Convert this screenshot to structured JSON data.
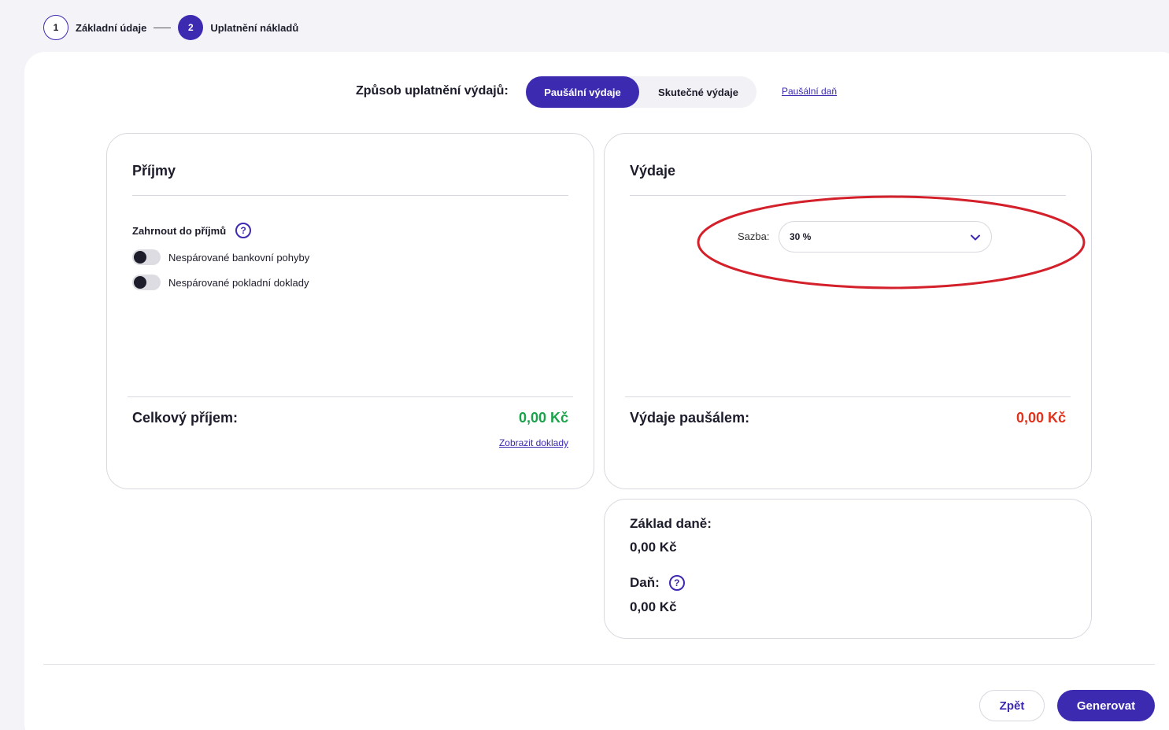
{
  "stepper": {
    "steps": [
      {
        "number": "1",
        "label": "Základní údaje",
        "state": "inactive"
      },
      {
        "number": "2",
        "label": "Uplatnění nákladů",
        "state": "active"
      }
    ]
  },
  "method": {
    "label": "Způsob uplatnění výdajů:",
    "options": [
      "Paušální výdaje",
      "Skutečné výdaje"
    ],
    "selected": "Paušální výdaje",
    "link": "Paušální daň"
  },
  "income": {
    "title": "Příjmy",
    "include_label": "Zahrnout do příjmů",
    "help_icon": "?",
    "toggles": [
      {
        "label": "Nespárované bankovní pohyby",
        "on": false
      },
      {
        "label": "Nespárované pokladní doklady",
        "on": false
      }
    ],
    "total_label": "Celkový příjem:",
    "total_value": "0,00 Kč",
    "total_color": "#1aa34a",
    "link": "Zobrazit doklady"
  },
  "expenses": {
    "title": "Výdaje",
    "rate_label": "Sazba:",
    "rate_value": "30 %",
    "total_label": "Výdaje paušálem:",
    "total_value": "0,00 Kč",
    "total_color": "#e0321c"
  },
  "tax": {
    "base_label": "Základ daně:",
    "base_value": "0,00 Kč",
    "tax_label": "Daň:",
    "help_icon": "?",
    "tax_value": "0,00 Kč"
  },
  "actions": {
    "back": "Zpět",
    "generate": "Generovat"
  },
  "colors": {
    "accent": "#3c2ab0",
    "annotation": "#d3202a"
  }
}
